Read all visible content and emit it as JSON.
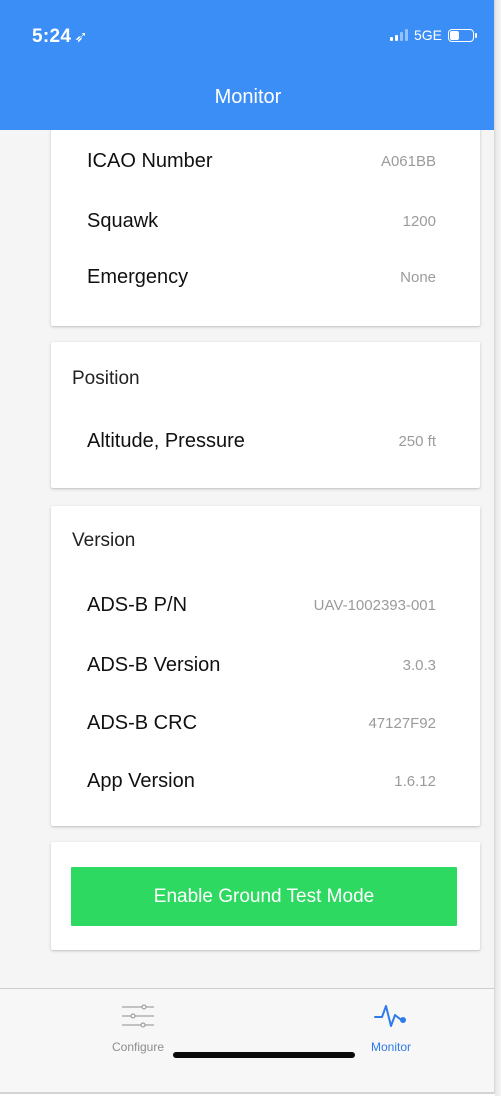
{
  "status_bar": {
    "time": "5:24",
    "location_glyph": "➶",
    "network": "5GE"
  },
  "header": {
    "title": "Monitor"
  },
  "cards": {
    "identity": {
      "rows": [
        {
          "label": "ICAO Number",
          "value": "A061BB"
        },
        {
          "label": "Squawk",
          "value": "1200"
        },
        {
          "label": "Emergency",
          "value": "None"
        }
      ]
    },
    "position": {
      "title": "Position",
      "rows": [
        {
          "label": "Altitude, Pressure",
          "value": "250 ft"
        }
      ]
    },
    "version": {
      "title": "Version",
      "rows": [
        {
          "label": "ADS-B P/N",
          "value": "UAV-1002393-001"
        },
        {
          "label": "ADS-B Version",
          "value": "3.0.3"
        },
        {
          "label": "ADS-B CRC",
          "value": "47127F92"
        },
        {
          "label": "App Version",
          "value": "1.6.12"
        }
      ]
    },
    "actions": {
      "ground_test_label": "Enable Ground Test Mode"
    }
  },
  "tabbar": {
    "tabs": [
      {
        "label": "Configure",
        "icon": "sliders-icon",
        "active": false
      },
      {
        "label": "Monitor",
        "icon": "pulse-icon",
        "active": true
      }
    ]
  },
  "colors": {
    "header": "#3b8ef6",
    "button": "#2dd960",
    "active_tab": "#2f7bea",
    "inactive_tab": "#8e8e8e"
  }
}
